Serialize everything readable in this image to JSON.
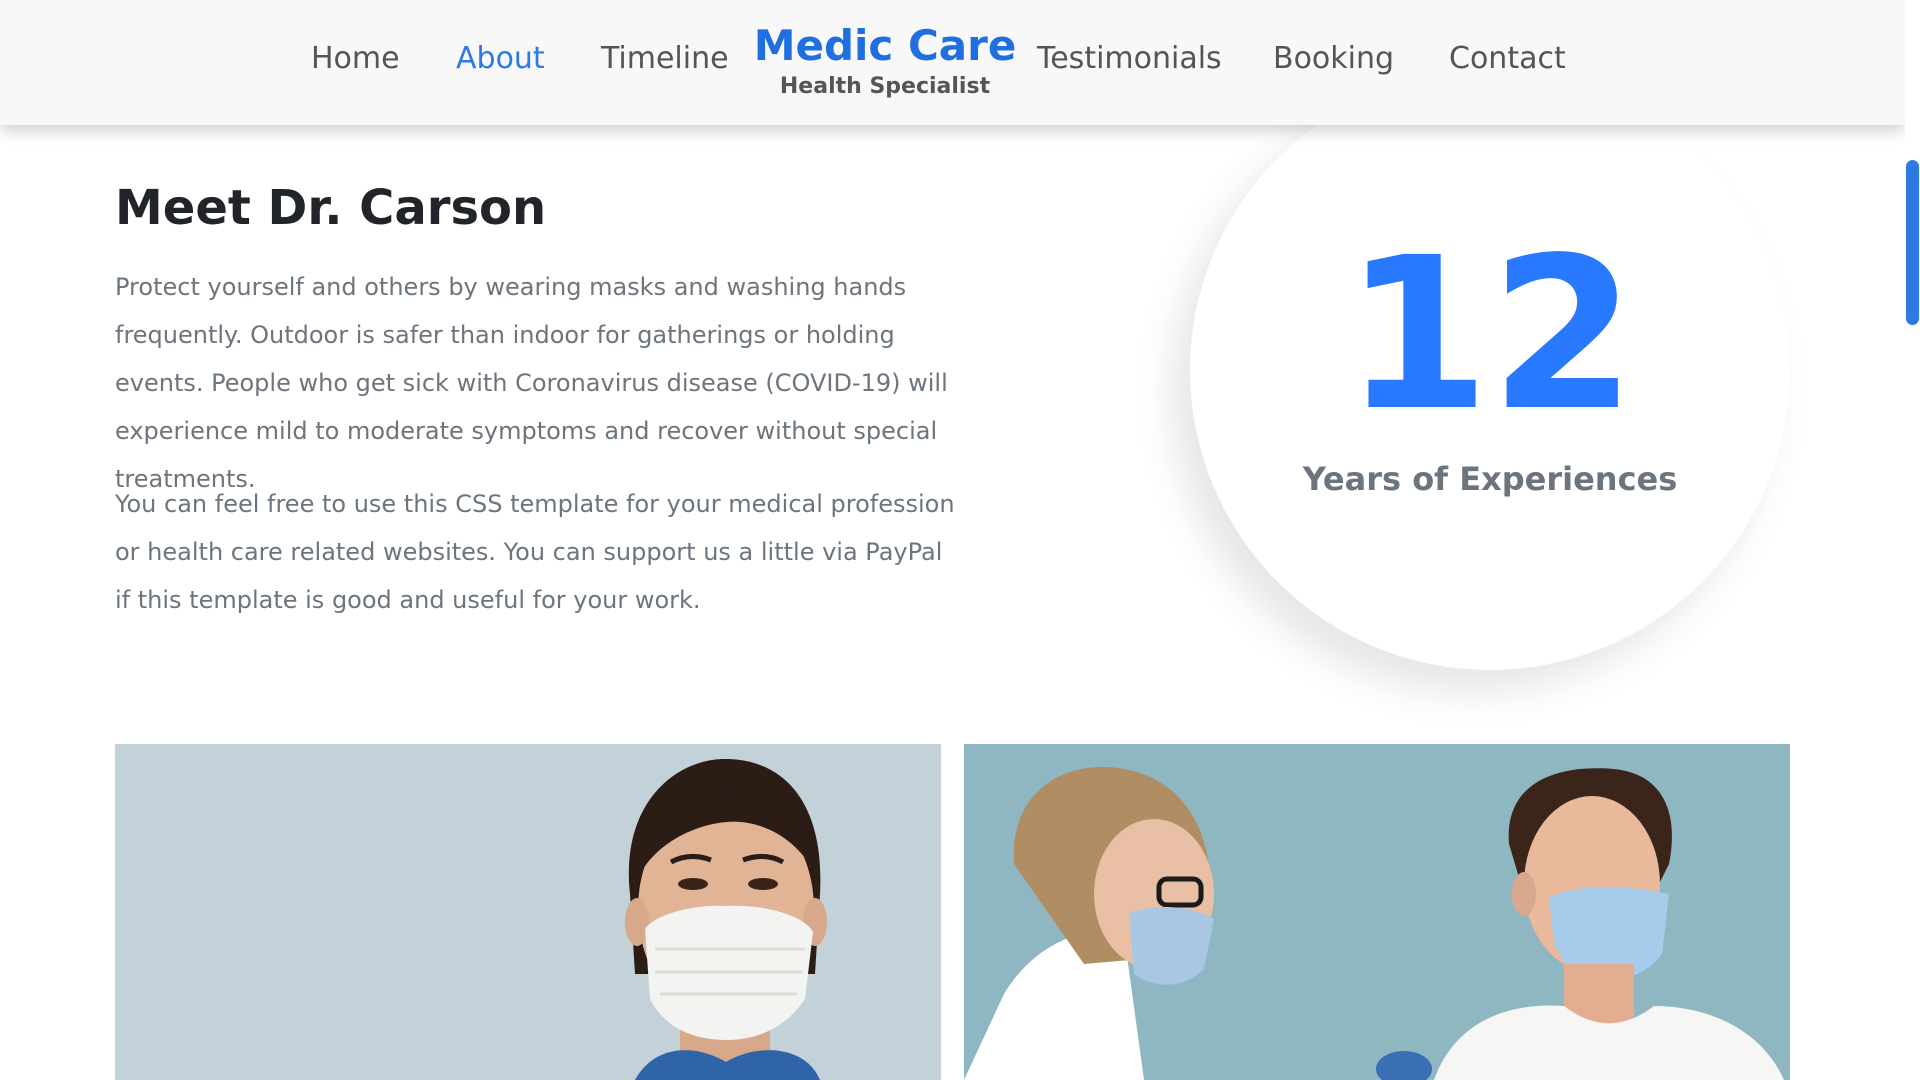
{
  "nav": {
    "links": [
      "Home",
      "About",
      "Timeline",
      "Testimonials",
      "Booking",
      "Contact"
    ],
    "active": "About",
    "brand_title": "Medic Care",
    "brand_subtitle": "Health Specialist"
  },
  "about": {
    "title": "Meet Dr. Carson",
    "paragraph_1": "Protect yourself and others by wearing masks and washing hands frequently. Outdoor is safer than indoor for gatherings or holding events. People who get sick with Coronavirus disease (COVID-19) will experience mild to moderate symptoms and recover without special treatments.",
    "paragraph_2": "You can feel free to use this CSS template for your medical profession or health care related websites. You can support us a little via PayPal if this template is good and useful for your work."
  },
  "experience": {
    "number": "12",
    "label": "Years of Experiences"
  },
  "colors": {
    "accent": "#2d7ae3",
    "number": "#2979ff",
    "heading": "#212529",
    "body_text": "#6c757d"
  },
  "icons": {
    "left_photo": "masked-nurse-photo",
    "right_photo": "vaccination-photo"
  }
}
